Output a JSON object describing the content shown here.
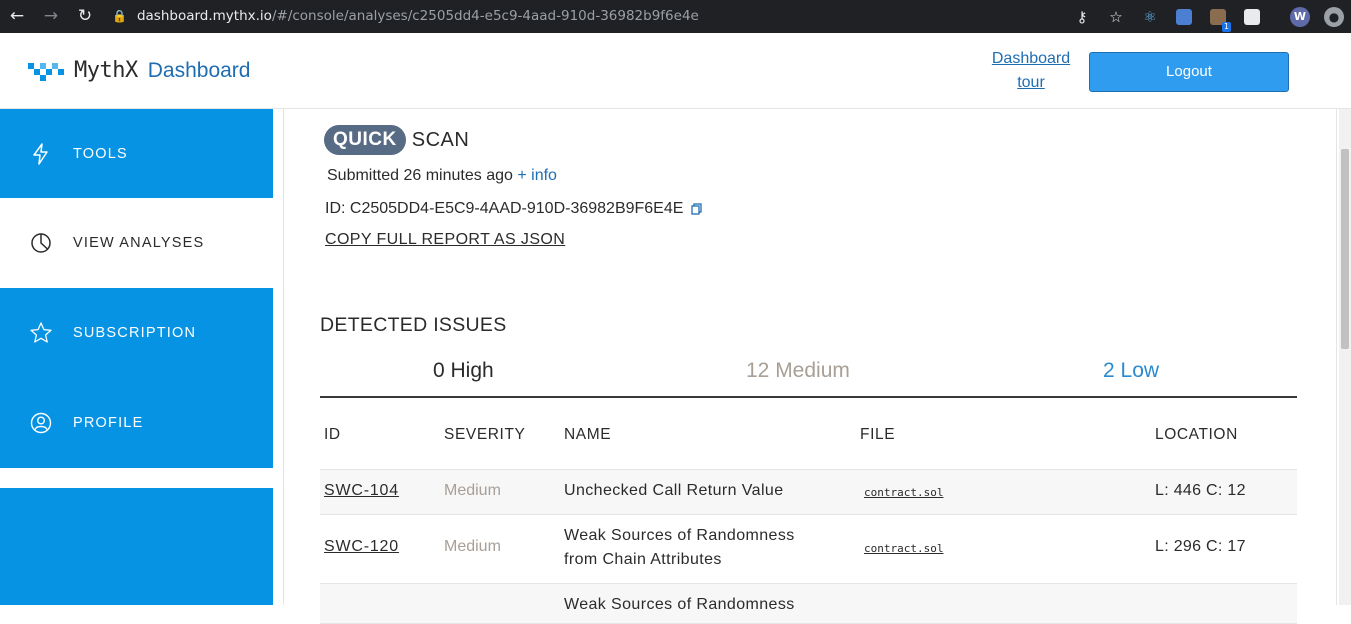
{
  "browser": {
    "url_host": "dashboard.mythx.io",
    "url_path": "/#/console/analyses/c2505dd4-e5c9-4aad-910d-36982b9f6e4e",
    "extension_badge": "1",
    "profile_initial": "W"
  },
  "header": {
    "logo_text": "MythX",
    "logo_sub": "Dashboard",
    "tour_line1": "Dashboard",
    "tour_line2": "tour",
    "logout_label": "Logout"
  },
  "sidebar": {
    "items": [
      {
        "label": "TOOLS",
        "icon": "lightning-icon"
      },
      {
        "label": "VIEW ANALYSES",
        "icon": "pie-chart-icon"
      },
      {
        "label": "SUBSCRIPTION",
        "icon": "star-icon"
      },
      {
        "label": "PROFILE",
        "icon": "user-circle-icon"
      }
    ]
  },
  "scan": {
    "mode": "QUICK",
    "type": "SCAN",
    "submitted": "Submitted 26 minutes ago",
    "info_link": "+ info",
    "id_prefix": "ID:",
    "id_value": "C2505DD4-E5C9-4AAD-910D-36982B9F6E4E",
    "copy_json": "COPY FULL REPORT AS JSON"
  },
  "issues": {
    "title": "DETECTED ISSUES",
    "tabs": {
      "high": "0 High",
      "medium": "12 Medium",
      "low": "2 Low"
    },
    "columns": [
      "ID",
      "SEVERITY",
      "NAME",
      "FILE",
      "LOCATION"
    ],
    "rows": [
      {
        "id": "SWC-104",
        "severity": "Medium",
        "name": "Unchecked Call Return Value",
        "name2": "",
        "file": "contract.sol",
        "location": "L: 446 C: 12"
      },
      {
        "id": "SWC-120",
        "severity": "Medium",
        "name": "Weak Sources of Randomness",
        "name2": "from Chain Attributes",
        "file": "contract.sol",
        "location": "L: 296 C: 17"
      },
      {
        "id": "",
        "severity": "",
        "name": "Weak Sources of Randomness",
        "name2": "",
        "file": "",
        "location": ""
      }
    ]
  }
}
